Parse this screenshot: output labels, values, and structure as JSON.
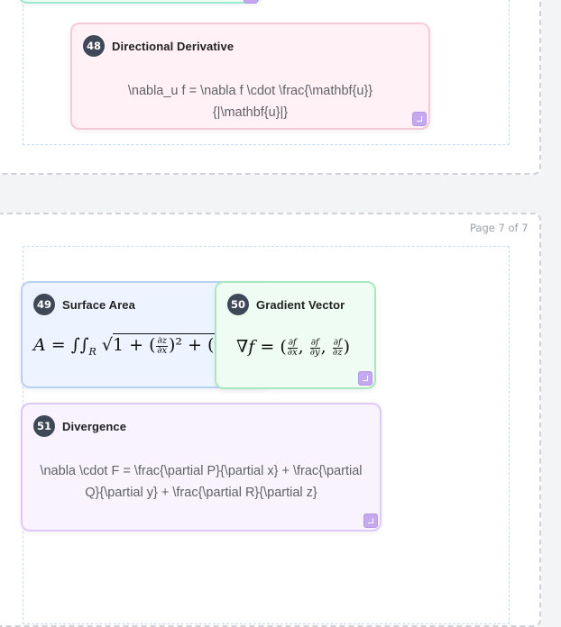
{
  "pages": {
    "page7_label": "Page 7 of 7"
  },
  "cards": {
    "c48": {
      "number": "48",
      "title": "Directional Derivative",
      "latex": "\\nabla_u f = \\nabla f \\cdot \\frac{\\mathbf{u}}{|\\mathbf{u}|}"
    },
    "c49": {
      "number": "49",
      "title": "Surface Area"
    },
    "c50": {
      "number": "50",
      "title": "Gradient Vector"
    },
    "c51": {
      "number": "51",
      "title": "Divergence",
      "latex": "\\nabla \\cdot F = \\frac{\\partial P}{\\partial x} + \\frac{\\partial Q}{\\partial y} + \\frac{\\partial R}{\\partial z}"
    }
  },
  "colors": {
    "card48_bg": "#fff1f5",
    "card48_border": "#f7c9d8",
    "card49_bg": "#eef4ff",
    "card49_border": "#b7d2f3",
    "card50_bg": "#effcf4",
    "card50_border": "#a9e8bf",
    "card51_bg": "#f8f3ff",
    "card51_border": "#dccbf5",
    "top_card_border": "#9de9d2"
  }
}
